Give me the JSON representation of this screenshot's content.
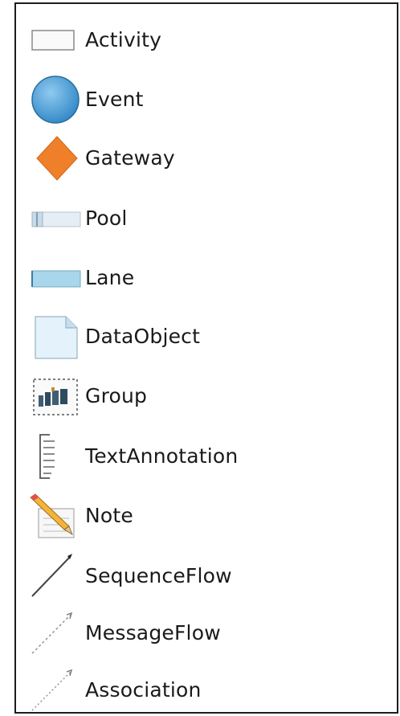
{
  "palette": {
    "items": [
      {
        "label": "Activity",
        "icon": "activity-icon"
      },
      {
        "label": "Event",
        "icon": "event-icon"
      },
      {
        "label": "Gateway",
        "icon": "gateway-icon"
      },
      {
        "label": "Pool",
        "icon": "pool-icon"
      },
      {
        "label": "Lane",
        "icon": "lane-icon"
      },
      {
        "label": "DataObject",
        "icon": "data-object-icon"
      },
      {
        "label": "Group",
        "icon": "group-icon"
      },
      {
        "label": "TextAnnotation",
        "icon": "text-annotation-icon"
      },
      {
        "label": "Note",
        "icon": "note-icon"
      },
      {
        "label": "SequenceFlow",
        "icon": "sequence-flow-icon"
      },
      {
        "label": "MessageFlow",
        "icon": "message-flow-icon"
      },
      {
        "label": "Association",
        "icon": "association-icon"
      }
    ]
  },
  "colors": {
    "event_fill": "#4a9fd6",
    "gateway_fill": "#f07f2a",
    "lane_fill": "#a9d6ea",
    "pool_fill": "#d8e6ee"
  }
}
